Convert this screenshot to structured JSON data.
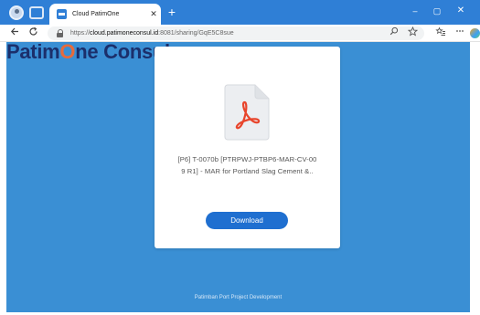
{
  "browser": {
    "tab_title": "Cloud PatimOne",
    "tab_close": "✕",
    "new_tab": "+",
    "window_controls": {
      "minimize": "–",
      "maximize": "▢",
      "close": "✕"
    },
    "url_prefix": "https://",
    "url_domain": "cloud.patimoneconsul.id",
    "url_path": ":8081/sharing/GqE5C8sue",
    "icons": {
      "profile": "profile-icon",
      "workspaces": "workspaces-icon",
      "back": "back-arrow-icon",
      "reload": "reload-icon",
      "lock": "lock-icon",
      "search": "search-icon",
      "favorite": "star-icon",
      "favorites": "favorites-icon",
      "more": "more-icon",
      "copilot": "copilot-icon"
    },
    "colors": {
      "titlebar": "#2f7fd6"
    }
  },
  "page": {
    "logo_part1": "Patim",
    "logo_o": "O",
    "logo_part2": "ne Consul",
    "file_name_line1": "[P6] T-0070b [PTRPWJ-PTBP6-MAR-CV-00",
    "file_name_line2": "9 R1] - MAR for Portland Slag Cement &..",
    "download_label": "Download",
    "footer": "Patimban Port Project Development",
    "file_icon": "pdf-file-icon",
    "colors": {
      "background": "#3a8fd4",
      "accent": "#e86a3a",
      "button": "#1f6fd0",
      "logo": "#1b2f6b"
    }
  }
}
